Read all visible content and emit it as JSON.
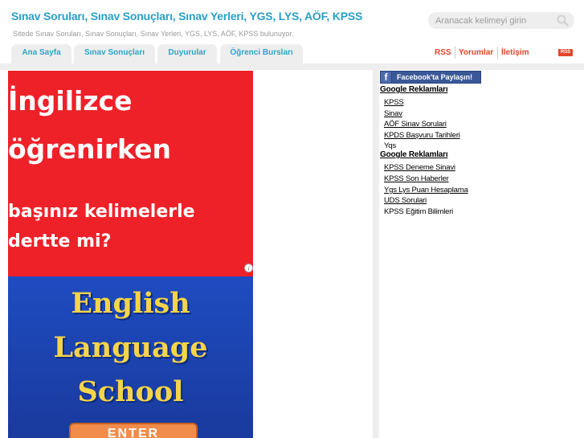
{
  "header": {
    "site_title": "Sınav Soruları, Sınav Sonuçları, Sınav Yerleri, YGS, LYS, AÖF, KPSS",
    "site_description": "Sitede Sınav Soruları, Sınav Sonuçları, Sınav Yerleri, YGS, LYS, AÖF, KPSS bulunuyor.",
    "search_placeholder": "Aranacak kelimeyi girin",
    "search_icon": "magnifier-icon"
  },
  "nav": {
    "tabs": [
      {
        "label": "Ana Sayfa"
      },
      {
        "label": "Sınav Sonuçları"
      },
      {
        "label": "Duyurular"
      },
      {
        "label": "Öğrenci Bursları"
      }
    ],
    "top_links": [
      {
        "label": "RSS"
      },
      {
        "label": "Yorumlar"
      },
      {
        "label": "İletişim"
      }
    ],
    "rss_badge": "RSS"
  },
  "ad": {
    "line1": "İngilizce",
    "line2": "öğrenirken",
    "line3": "başınız kelimelerle",
    "line4": "dertte mi?",
    "school1": "English",
    "school2": "Language",
    "school3": "School",
    "cta": "ENTER",
    "info_icon": "info-icon"
  },
  "sidebar": {
    "facebook_icon_glyph": "f",
    "facebook_share": "Facebook'ta Paylaşın!",
    "ad_groups": [
      {
        "heading": "Google Reklamları",
        "links": [
          {
            "label": "KPSS",
            "underlined": true
          },
          {
            "label": "Sinav",
            "underlined": true
          },
          {
            "label": "AÖF Sinav Sorulari",
            "underlined": true
          },
          {
            "label": "KPDS Başvuru Tarihleri",
            "underlined": true
          },
          {
            "label": "Yqs",
            "underlined": false
          }
        ]
      },
      {
        "heading": "Google Reklamları",
        "links": [
          {
            "label": "KPSS Deneme Sinavi",
            "underlined": true
          },
          {
            "label": "KPSS Son Haberler",
            "underlined": true
          },
          {
            "label": "Ygs Lys Puan Hesaplama",
            "underlined": true
          },
          {
            "label": "UDS Sorulari",
            "underlined": true
          },
          {
            "label": "KPSS Eğitim Bilimleri",
            "underlined": false
          }
        ]
      }
    ]
  },
  "colors": {
    "title_blue": "#2a9fc7",
    "link_red": "#e8432b",
    "tab_grey": "#eeeeee",
    "ad_red": "#ee2129",
    "ad_blue": "#1e4cc1",
    "ad_gold": "#f6d44a",
    "facebook_blue": "#3b5998"
  }
}
